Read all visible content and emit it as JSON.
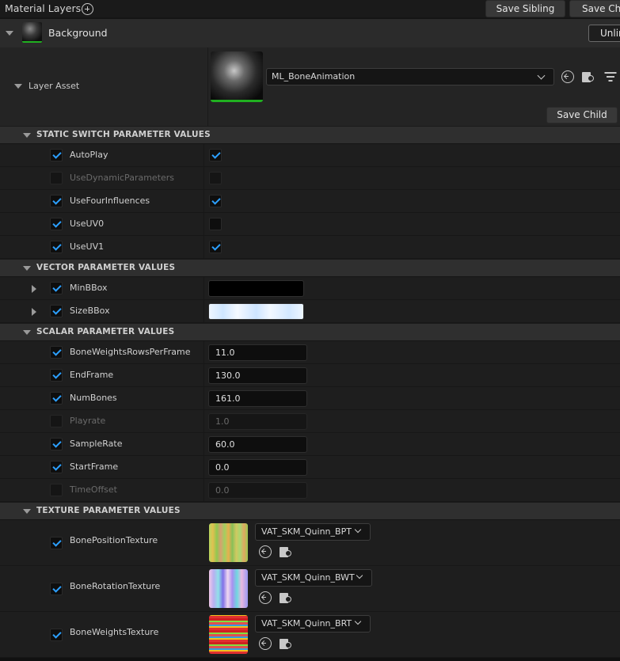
{
  "panel": {
    "title": "Material Layers",
    "save_sibling": "Save Sibling",
    "save_child_top": "Save Ch"
  },
  "layer": {
    "name": "Background",
    "unlink": "Unlin"
  },
  "layer_asset": {
    "label": "Layer Asset",
    "asset_name": "ML_BoneAnimation",
    "save_child": "Save Child"
  },
  "sections": {
    "static_switch": "STATIC SWITCH PARAMETER VALUES",
    "vector": "VECTOR PARAMETER VALUES",
    "scalar": "SCALAR PARAMETER VALUES",
    "texture": "TEXTURE PARAMETER VALUES"
  },
  "static_switch_params": [
    {
      "name": "AutoPlay",
      "enabled": true,
      "value": true
    },
    {
      "name": "UseDynamicParameters",
      "enabled": false,
      "value": false
    },
    {
      "name": "UseFourInfluences",
      "enabled": true,
      "value": true
    },
    {
      "name": "UseUV0",
      "enabled": true,
      "value": false
    },
    {
      "name": "UseUV1",
      "enabled": true,
      "value": true
    }
  ],
  "vector_params": [
    {
      "name": "MinBBox",
      "enabled": true,
      "color": "#000000"
    },
    {
      "name": "SizeBBox",
      "enabled": true,
      "color": "#e6f2ff"
    }
  ],
  "scalar_params": [
    {
      "name": "BoneWeightsRowsPerFrame",
      "enabled": true,
      "value": "11.0"
    },
    {
      "name": "EndFrame",
      "enabled": true,
      "value": "130.0"
    },
    {
      "name": "NumBones",
      "enabled": true,
      "value": "161.0"
    },
    {
      "name": "Playrate",
      "enabled": false,
      "value": "1.0"
    },
    {
      "name": "SampleRate",
      "enabled": true,
      "value": "60.0"
    },
    {
      "name": "StartFrame",
      "enabled": true,
      "value": "0.0"
    },
    {
      "name": "TimeOffset",
      "enabled": false,
      "value": "0.0"
    }
  ],
  "texture_params": [
    {
      "name": "BonePositionTexture",
      "enabled": true,
      "asset": "VAT_SKM_Quinn_BPT"
    },
    {
      "name": "BoneRotationTexture",
      "enabled": true,
      "asset": "VAT_SKM_Quinn_BWT"
    },
    {
      "name": "BoneWeightsTexture",
      "enabled": true,
      "asset": "VAT_SKM_Quinn_BRT"
    }
  ],
  "colors": {
    "accent_check": "#2ca0ff",
    "asset_valid": "#20b020"
  }
}
